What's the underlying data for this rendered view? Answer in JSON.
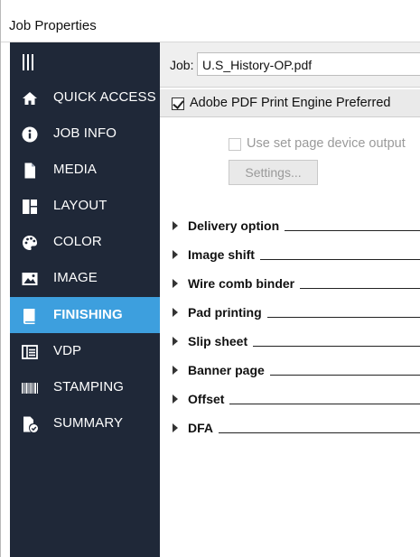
{
  "window": {
    "title": "Job Properties"
  },
  "sidebar": {
    "items": [
      {
        "label": "QUICK ACCESS",
        "icon": "home-icon",
        "active": false
      },
      {
        "label": "JOB INFO",
        "icon": "info-icon",
        "active": false
      },
      {
        "label": "MEDIA",
        "icon": "document-icon",
        "active": false
      },
      {
        "label": "LAYOUT",
        "icon": "layout-icon",
        "active": false
      },
      {
        "label": "COLOR",
        "icon": "palette-icon",
        "active": false
      },
      {
        "label": "IMAGE",
        "icon": "image-icon",
        "active": false
      },
      {
        "label": "FINISHING",
        "icon": "book-icon",
        "active": true
      },
      {
        "label": "VDP",
        "icon": "vdp-icon",
        "active": false
      },
      {
        "label": "STAMPING",
        "icon": "barcode-icon",
        "active": false
      },
      {
        "label": "SUMMARY",
        "icon": "summary-icon",
        "active": false
      }
    ],
    "active_color": "#3d9fde",
    "background_color": "#1f2838"
  },
  "job": {
    "label": "Job:",
    "value": "U.S_History-OP.pdf"
  },
  "apee": {
    "label": "Adobe PDF Print Engine Preferred",
    "checked": true
  },
  "device_output": {
    "label": "Use set page device output",
    "checked": false,
    "enabled": false
  },
  "settings_button": {
    "label": "Settings...",
    "enabled": false
  },
  "sections": [
    {
      "label": "Delivery option"
    },
    {
      "label": "Image shift"
    },
    {
      "label": "Wire comb binder"
    },
    {
      "label": "Pad printing"
    },
    {
      "label": "Slip sheet"
    },
    {
      "label": "Banner page"
    },
    {
      "label": "Offset"
    },
    {
      "label": "DFA"
    }
  ]
}
